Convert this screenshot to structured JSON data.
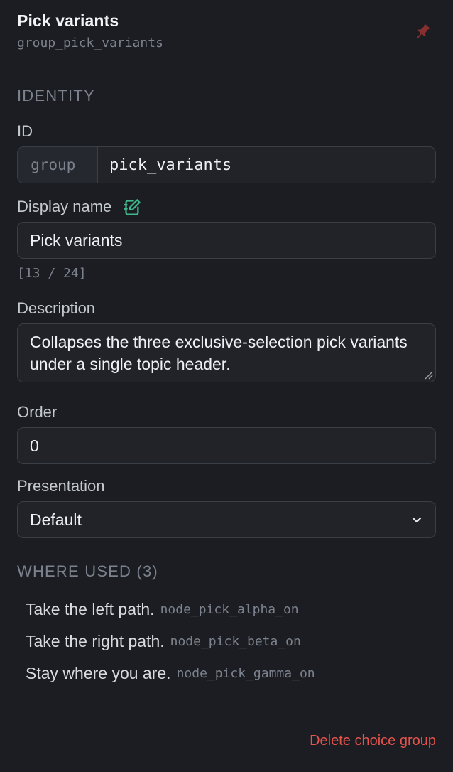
{
  "header": {
    "title": "Pick variants",
    "subtitle": "group_pick_variants",
    "pin_icon": "pin-icon"
  },
  "identity": {
    "section_label": "IDENTITY",
    "id_label": "ID",
    "id_prefix": "group_",
    "id_value": "pick_variants",
    "display_name_label": "Display name",
    "display_name_icon": "edit-icon",
    "display_name_value": "Pick variants",
    "display_name_counter": "[13 / 24]",
    "description_label": "Description",
    "description_value": "Collapses the three exclusive-selection pick variants under a single topic header.",
    "order_label": "Order",
    "order_value": "0",
    "presentation_label": "Presentation",
    "presentation_value": "Default"
  },
  "where_used": {
    "section_label": "WHERE USED (3)",
    "items": [
      {
        "text": "Take the left path.",
        "code": "node_pick_alpha_on"
      },
      {
        "text": "Take the right path.",
        "code": "node_pick_beta_on"
      },
      {
        "text": "Stay where you are.",
        "code": "node_pick_gamma_on"
      }
    ]
  },
  "footer": {
    "delete_label": "Delete choice group"
  },
  "colors": {
    "background": "#1b1d22",
    "accent_green": "#3fb68b",
    "danger": "#e5534b",
    "pin": "#8a2f2f"
  }
}
